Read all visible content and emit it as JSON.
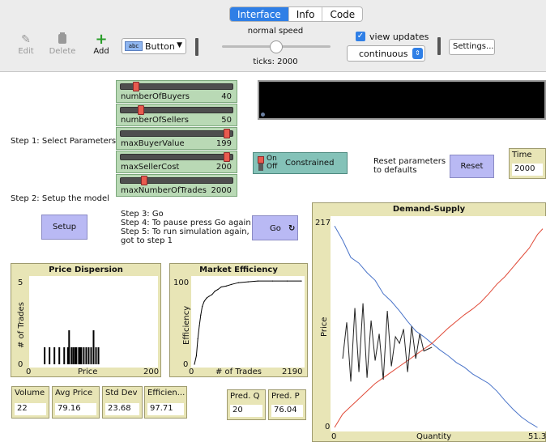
{
  "tabs": [
    "Interface",
    "Info",
    "Code"
  ],
  "toolbar": {
    "edit": "Edit",
    "delete": "Delete",
    "add": "Add",
    "widget_type": "Button",
    "speed": "normal speed",
    "ticks": "ticks: 2000",
    "view_updates": "view updates",
    "update_mode": "continuous",
    "settings": "Settings..."
  },
  "sliders": [
    {
      "label": "numberOfBuyers",
      "value": "40",
      "level": 0.12
    },
    {
      "label": "numberOfSellers",
      "value": "50",
      "level": 0.17
    },
    {
      "label": "maxBuyerValue",
      "value": "199",
      "level": 0.97
    },
    {
      "label": "maxSellerCost",
      "value": "200",
      "level": 0.97
    },
    {
      "label": "maxNumberOfTrades",
      "value": "2000",
      "level": 0.2
    }
  ],
  "steps": {
    "step1": "Step 1:  Select Parameters",
    "step2": "Step 2:  Setup the model",
    "step345": [
      "Step 3:  Go",
      "Step 4:  To pause press Go again",
      "Step 5:  To run simulation again,",
      "got to step 1"
    ]
  },
  "switch": {
    "on": "On",
    "off": "Off",
    "label": "Constrained"
  },
  "reset": {
    "note": [
      "Reset parameters",
      "to defaults"
    ],
    "label": "Reset"
  },
  "time": {
    "label": "Time",
    "value": "2000"
  },
  "setup_label": "Setup",
  "go_label": "Go",
  "monitors": [
    {
      "label": "Volume",
      "value": "22"
    },
    {
      "label": "Avg Price",
      "value": "79.16"
    },
    {
      "label": "Std Dev",
      "value": "23.68"
    },
    {
      "label": "Efficien...",
      "value": "97.71"
    },
    {
      "label": "Pred. Q",
      "value": "20"
    },
    {
      "label": "Pred. P",
      "value": "76.04"
    }
  ],
  "price_dispersion": {
    "title": "Price Dispersion",
    "ylabel": "# of Trades",
    "xlabel": "Price",
    "ymax": "5",
    "ymin": "0",
    "xmin": "0",
    "xmax": "200"
  },
  "market_efficiency": {
    "title": "Market Efficiency",
    "ylabel": "Efficiency",
    "xlabel": "# of Trades",
    "ymax": "100",
    "ymin": "0",
    "xmin": "0",
    "xmax": "2190"
  },
  "demand_supply": {
    "title": "Demand-Supply",
    "ylabel": "Price",
    "xlabel": "Quantity",
    "ymax": "217",
    "ymin": "0",
    "xmin": "0",
    "xmax": "51.3"
  },
  "chart_data": [
    {
      "type": "bar",
      "title": "Price Dispersion",
      "xlabel": "Price",
      "ylabel": "# of Trades",
      "xlim": [
        0,
        200
      ],
      "ylim": [
        0,
        5
      ],
      "x": [
        20,
        28,
        36,
        44,
        52,
        58,
        60,
        64,
        67,
        70,
        72,
        76,
        78,
        80,
        84,
        88,
        92,
        96,
        100,
        104,
        108
      ],
      "values": [
        1,
        1,
        1,
        1,
        1,
        1,
        2,
        1,
        1,
        1,
        1,
        1,
        1,
        1,
        1,
        1,
        1,
        1,
        2,
        1,
        1
      ]
    },
    {
      "type": "line",
      "title": "Market Efficiency",
      "xlabel": "# of Trades",
      "ylabel": "Efficiency",
      "xlim": [
        0,
        2190
      ],
      "ylim": [
        0,
        100
      ],
      "x": [
        0,
        40,
        70,
        100,
        130,
        160,
        200,
        250,
        300,
        360,
        420,
        480,
        550,
        650,
        760,
        900,
        1100,
        1300,
        1600,
        1900,
        2190
      ],
      "values": [
        0,
        10,
        30,
        45,
        58,
        68,
        74,
        78,
        80,
        82,
        86,
        88,
        91,
        92,
        94,
        96,
        97,
        98,
        98,
        98,
        98
      ]
    },
    {
      "type": "line",
      "title": "Demand-Supply",
      "xlabel": "Quantity",
      "ylabel": "Price",
      "xlim": [
        0,
        51.3
      ],
      "ylim": [
        0,
        217
      ],
      "series": [
        {
          "x": [
            0,
            2,
            4,
            6,
            8,
            10,
            12,
            14,
            16,
            18,
            20,
            22,
            24,
            26,
            28,
            30,
            32,
            34,
            36,
            38,
            40,
            42,
            44,
            46,
            48,
            50
          ],
          "values": [
            211,
            196,
            178,
            172,
            162,
            154,
            140,
            132,
            122,
            111,
            101,
            95,
            88,
            81,
            75,
            68,
            63,
            56,
            51,
            46,
            38,
            28,
            19,
            11,
            5,
            0
          ]
        },
        {
          "x": [
            0,
            2,
            4,
            6,
            8,
            10,
            12,
            14,
            16,
            18,
            20,
            22,
            24,
            26,
            28,
            30,
            32,
            34,
            36,
            38,
            40,
            42,
            44,
            46,
            48,
            50,
            51.3
          ],
          "values": [
            0,
            14,
            22,
            30,
            38,
            46,
            52,
            58,
            64,
            70,
            76,
            82,
            88,
            96,
            104,
            111,
            118,
            124,
            131,
            140,
            150,
            158,
            168,
            178,
            188,
            202,
            208
          ]
        },
        {
          "x": [
            2,
            3,
            4,
            5,
            6,
            7,
            8,
            9,
            10,
            11,
            12,
            13,
            14,
            15,
            16,
            17,
            18,
            19,
            20,
            21,
            22,
            23,
            24
          ],
          "values": [
            72,
            110,
            48,
            125,
            58,
            130,
            52,
            112,
            70,
            98,
            50,
            122,
            64,
            95,
            88,
            103,
            58,
            106,
            72,
            98,
            80,
            82,
            84
          ]
        }
      ]
    }
  ]
}
